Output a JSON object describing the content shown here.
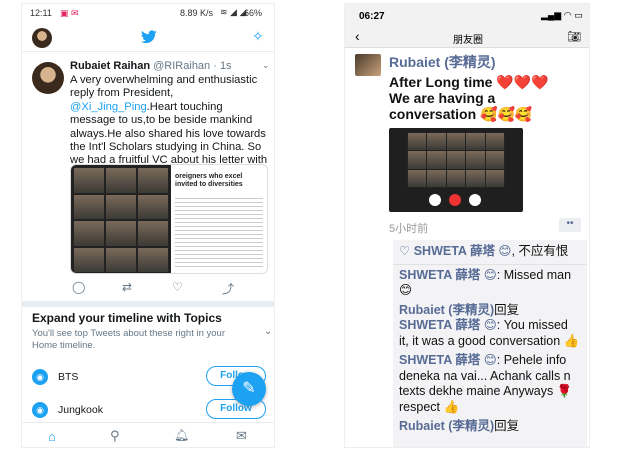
{
  "left": {
    "status": {
      "time": "12:11",
      "speed": "8.89 K/s",
      "battery": "66%"
    },
    "tweet": {
      "author": "Rubaiet Raihan",
      "handle": "@RIRaihan · 1s",
      "text_before": "A very overwhelming and enthusiastic reply from President, ",
      "mention": "@Xi_Jing_Ping",
      "text_after": ".Heart touching message to us,to be beside mankind always.He also shared his love towards the Int'l Scholars studying in China. So we had a fruitful VC about his letter with our International College of WTU.",
      "image_caption": "oreigners who excel invited to diversities"
    },
    "topics": {
      "title": "Expand your timeline with Topics",
      "subtitle": "You'll see top Tweets about these right in your Home timeline.",
      "items": [
        {
          "name": "BTS",
          "button": "Follow"
        },
        {
          "name": "Jungkook",
          "button": "Follow"
        }
      ]
    },
    "icons": {
      "compose": "compose-icon",
      "home": "home-icon",
      "search": "search-icon",
      "bell": "bell-icon",
      "mail": "mail-icon"
    }
  },
  "right": {
    "status": {
      "time": "06:27"
    },
    "title": "朋友圈",
    "post": {
      "author": "Rubaiet (李精灵)",
      "line1": "After Long time ❤️❤️❤️",
      "line2": "We are having a",
      "line3": "conversation 🥰🥰🥰",
      "time": "5小时前"
    },
    "likes": {
      "name": "SHWETA 薛塔 😊",
      "suffix": ", 不应有恨"
    },
    "comments": [
      {
        "name": "SHWETA 薛塔 😊",
        "text": ": Missed man 😊"
      },
      {
        "name": "Rubaiet (李精灵)",
        "text": "回复"
      },
      {
        "name": "SHWETA 薛塔 😊",
        "text": ": You missed it, it was a good conversation 👍"
      },
      {
        "name": "SHWETA 薛塔 😊",
        "text": ": Pehele info deneka na vai... Achank calls n texts dekhe maine Anyways 🌹 respect 👍"
      },
      {
        "name": "Rubaiet (李精灵)",
        "text": "回复"
      }
    ]
  }
}
